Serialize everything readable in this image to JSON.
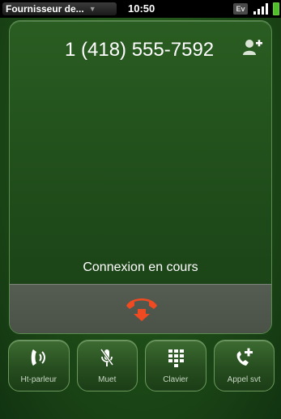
{
  "status_bar": {
    "carrier": "Fournisseur de...",
    "time": "10:50",
    "network_badge": "Ev",
    "icons": [
      "caret-down-icon",
      "signal-icon",
      "battery-icon"
    ]
  },
  "call": {
    "number": "1 (418) 555-7592",
    "status": "Connexion en cours",
    "icons": [
      "add-contact-icon",
      "end-call-icon"
    ],
    "end_call_color": "#f04a22"
  },
  "actions": [
    {
      "label": "Ht-parleur",
      "icon": "speaker-icon"
    },
    {
      "label": "Muet",
      "icon": "mute-icon"
    },
    {
      "label": "Clavier",
      "icon": "keypad-icon"
    },
    {
      "label": "Appel svt",
      "icon": "add-call-icon"
    }
  ],
  "colors": {
    "background_green": "#1d4a17",
    "accent_red": "#f04a22"
  }
}
